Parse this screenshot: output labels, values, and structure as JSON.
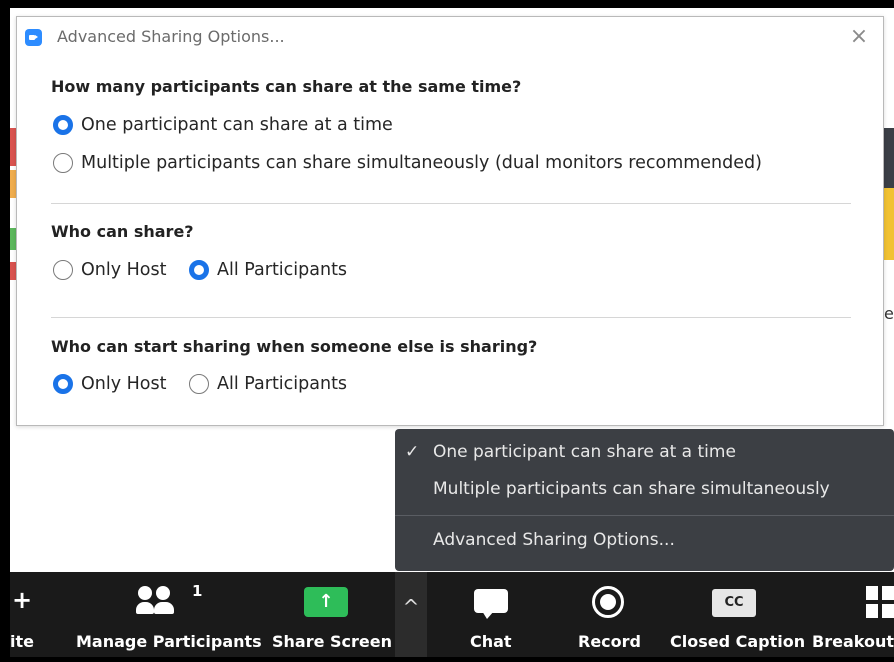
{
  "dialog": {
    "title": "Advanced Sharing Options...",
    "close_symbol": "×",
    "sections": [
      {
        "question": "How many participants can share at the same time?",
        "options": [
          {
            "label": "One participant can share at a time",
            "selected": true
          },
          {
            "label": "Multiple participants can share simultaneously (dual monitors recommended)",
            "selected": false
          }
        ]
      },
      {
        "question": "Who can share?",
        "options": [
          {
            "label": "Only Host",
            "selected": false
          },
          {
            "label": "All Participants",
            "selected": true
          }
        ]
      },
      {
        "question": "Who can start sharing when someone else is sharing?",
        "options": [
          {
            "label": "Only Host",
            "selected": true
          },
          {
            "label": "All Participants",
            "selected": false
          }
        ]
      }
    ]
  },
  "share_menu": {
    "check_symbol": "✓",
    "items": [
      {
        "label": "One participant can share at a time",
        "checked": true
      },
      {
        "label": "Multiple participants can share simultaneously",
        "checked": false
      },
      {
        "label": "Advanced Sharing Options...",
        "checked": false
      }
    ]
  },
  "toolbar": {
    "invite_label": "ite",
    "manage_participants_label": "Manage Participants",
    "participant_count": "1",
    "share_screen_label": "Share Screen",
    "share_arrow": "↑",
    "caret_symbol": "^",
    "chat_label": "Chat",
    "record_label": "Record",
    "cc_icon_text": "CC",
    "closed_caption_label": "Closed Caption",
    "breakout_label": "Breakout R"
  },
  "background": {
    "right_edge_letter": "e"
  },
  "colors": {
    "accent_blue": "#1a73e8",
    "share_green": "#2ebd59",
    "menu_bg": "#3c3f44",
    "toolbar_bg": "#1a1a1a"
  }
}
